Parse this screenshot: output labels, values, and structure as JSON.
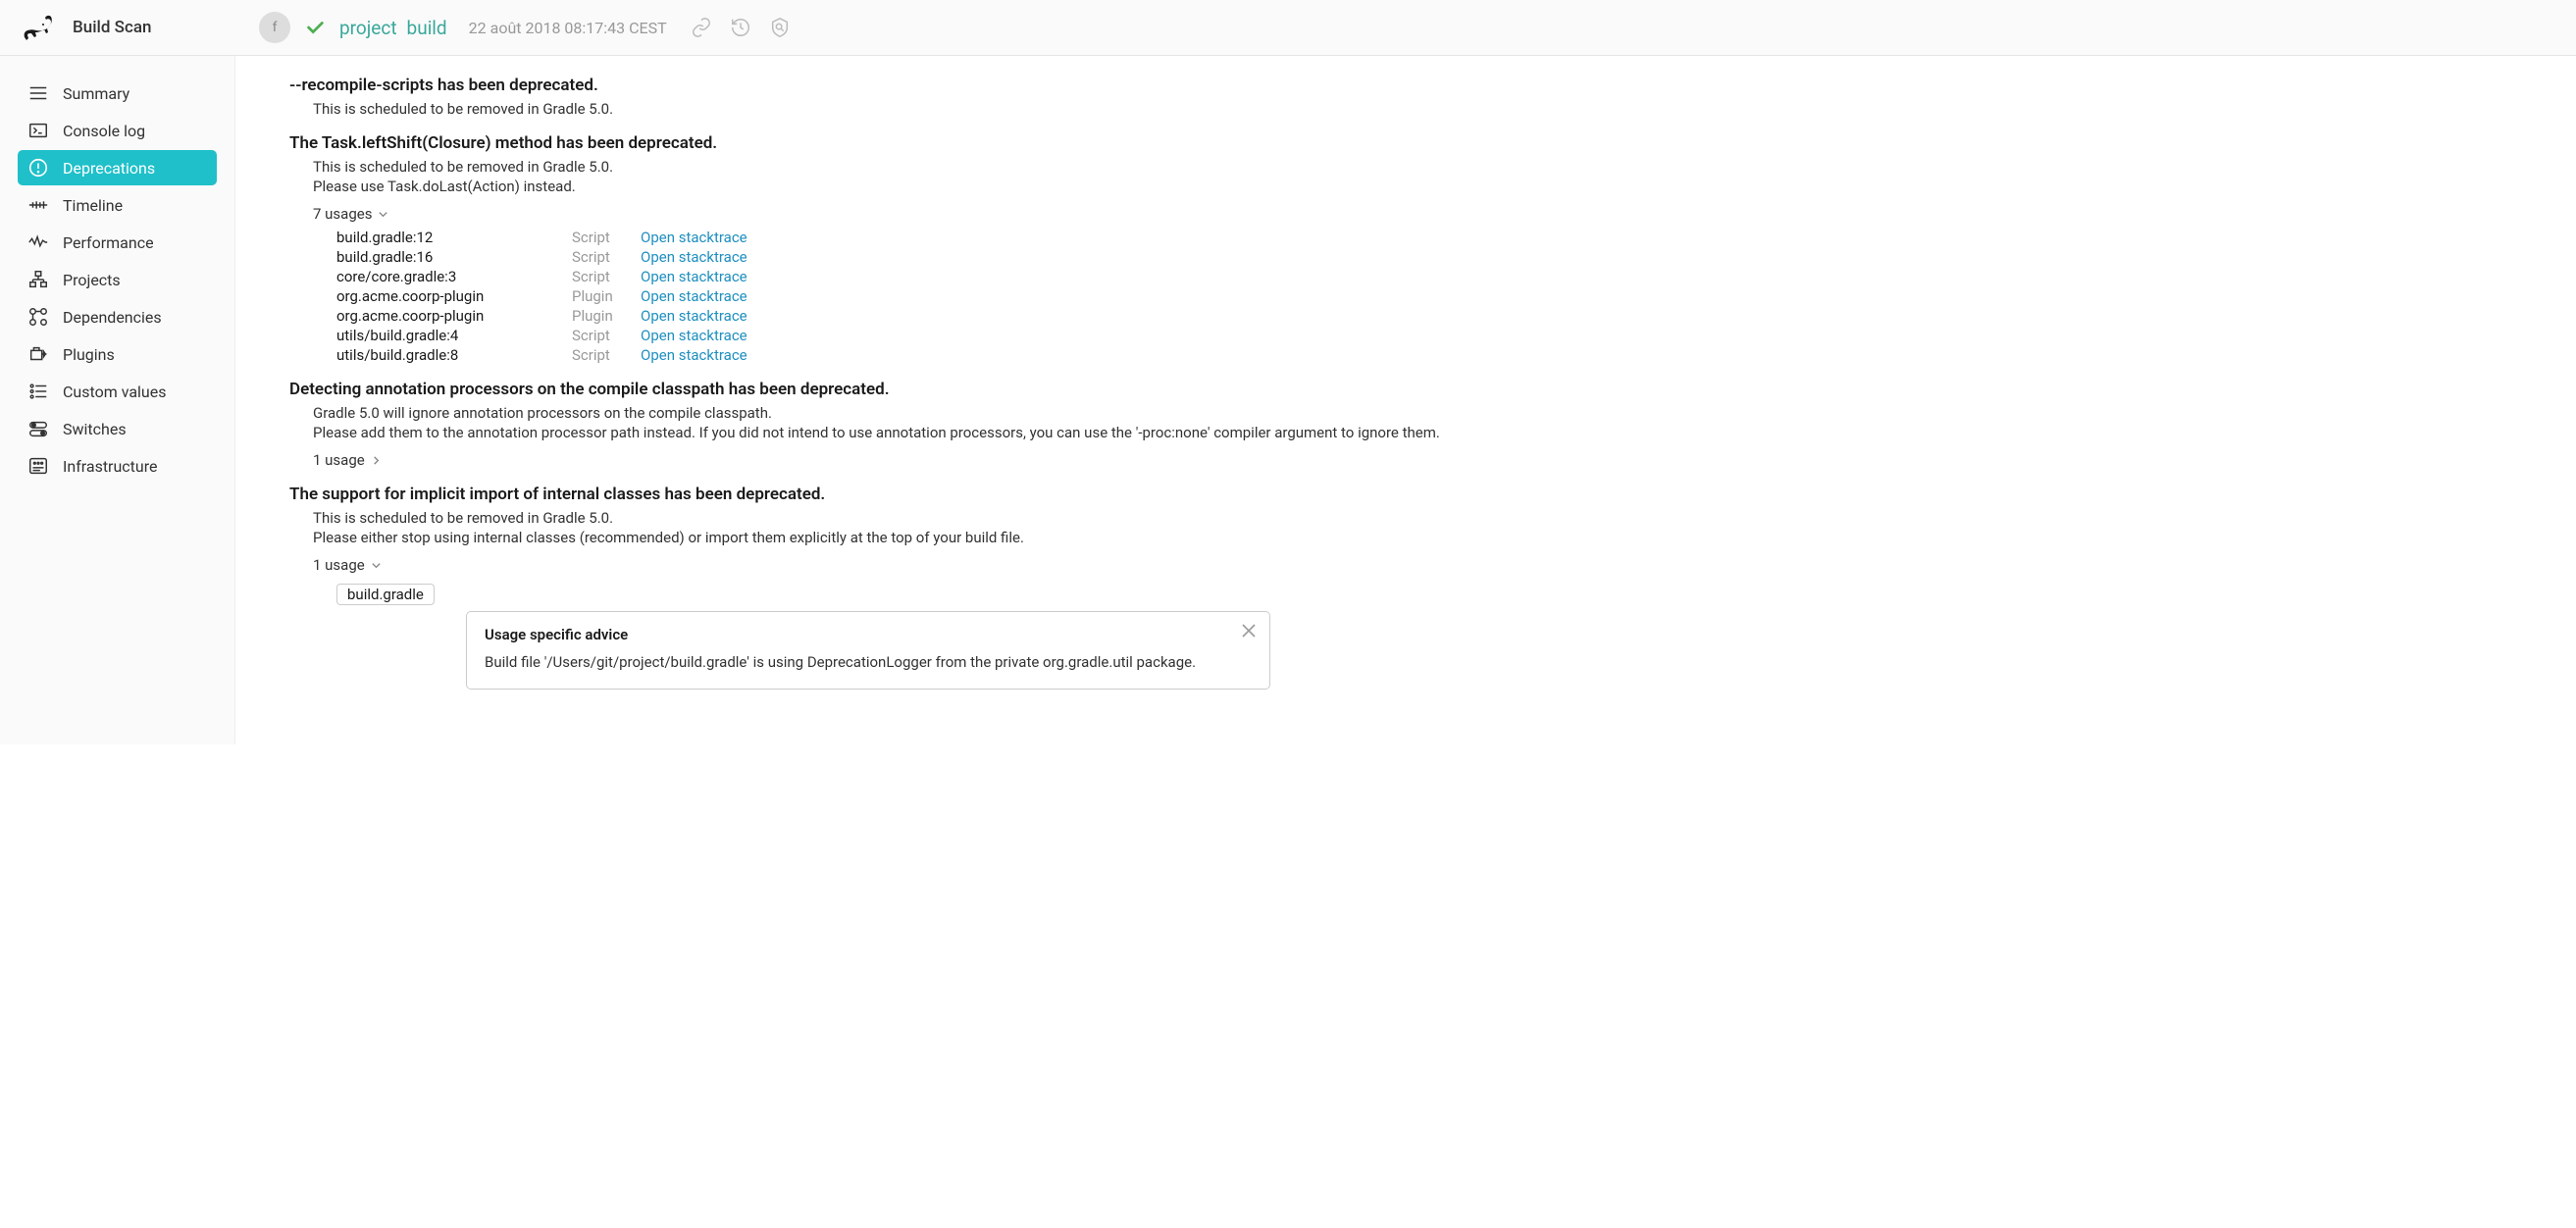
{
  "header": {
    "brand": "Build Scan",
    "avatar_initial": "f",
    "project": "project",
    "build": "build",
    "timestamp": "22 août 2018 08:17:43 CEST"
  },
  "sidebar": {
    "items": [
      {
        "label": "Summary"
      },
      {
        "label": "Console log"
      },
      {
        "label": "Deprecations"
      },
      {
        "label": "Timeline"
      },
      {
        "label": "Performance"
      },
      {
        "label": "Projects"
      },
      {
        "label": "Dependencies"
      },
      {
        "label": "Plugins"
      },
      {
        "label": "Custom values"
      },
      {
        "label": "Switches"
      },
      {
        "label": "Infrastructure"
      }
    ]
  },
  "deprecations": [
    {
      "title": "--recompile-scripts has been deprecated.",
      "descs": [
        "This is scheduled to be removed in Gradle 5.0."
      ]
    },
    {
      "title": "The Task.leftShift(Closure) method has been deprecated.",
      "descs": [
        "This is scheduled to be removed in Gradle 5.0.",
        "Please use Task.doLast(Action) instead."
      ],
      "usage_summary": "7 usages",
      "usages": [
        {
          "loc": "build.gradle:12",
          "kind": "Script",
          "link": "Open stacktrace"
        },
        {
          "loc": "build.gradle:16",
          "kind": "Script",
          "link": "Open stacktrace"
        },
        {
          "loc": "core/core.gradle:3",
          "kind": "Script",
          "link": "Open stacktrace"
        },
        {
          "loc": "org.acme.coorp-plugin",
          "kind": "Plugin",
          "link": "Open stacktrace"
        },
        {
          "loc": "org.acme.coorp-plugin",
          "kind": "Plugin",
          "link": "Open stacktrace"
        },
        {
          "loc": "utils/build.gradle:4",
          "kind": "Script",
          "link": "Open stacktrace"
        },
        {
          "loc": "utils/build.gradle:8",
          "kind": "Script",
          "link": "Open stacktrace"
        }
      ]
    },
    {
      "title": "Detecting annotation processors on the compile classpath has been deprecated.",
      "descs": [
        "Gradle 5.0 will ignore annotation processors on the compile classpath.",
        "Please add them to the annotation processor path instead. If you did not intend to use annotation processors, you can use the '-proc:none' compiler argument to ignore them."
      ],
      "usage_summary": "1 usage"
    },
    {
      "title": "The support for implicit import of internal classes has been deprecated.",
      "descs": [
        "This is scheduled to be removed in Gradle 5.0.",
        "Please either stop using internal classes (recommended) or import them explicitly at the top of your build file."
      ],
      "usage_summary": "1 usage",
      "file_pill": "build.gradle",
      "advice": {
        "title": "Usage specific advice",
        "body": "Build file '/Users/git/project/build.gradle' is using DeprecationLogger from the private org.gradle.util package."
      }
    }
  ]
}
